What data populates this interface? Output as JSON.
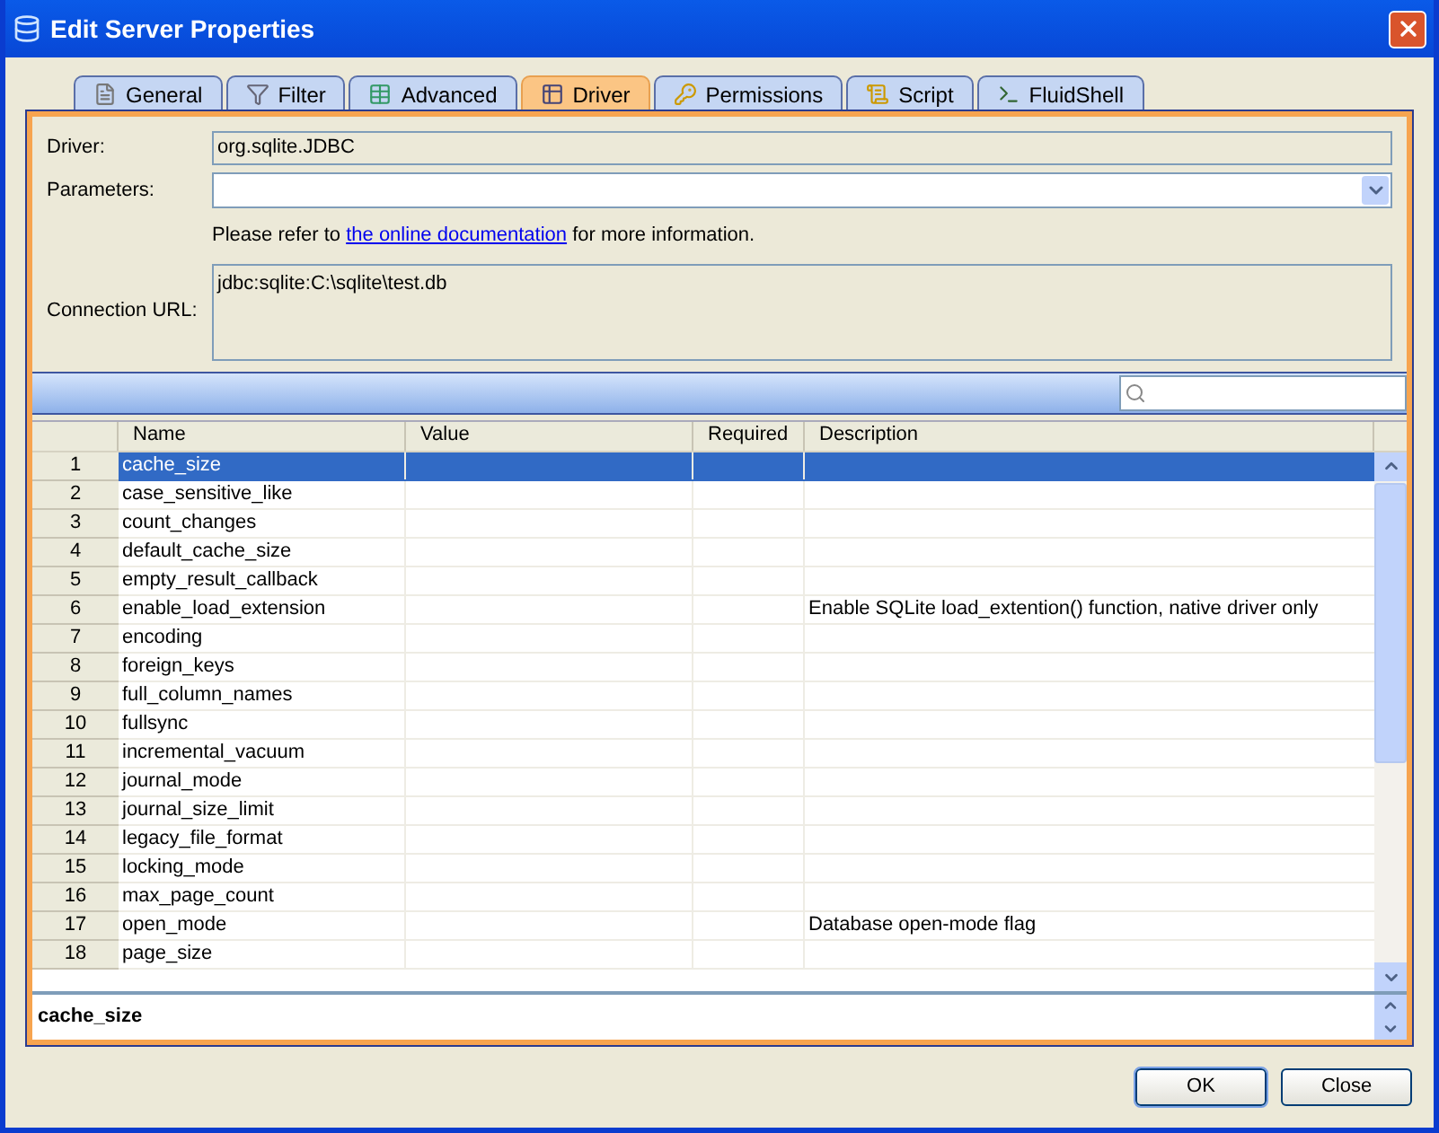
{
  "window": {
    "title": "Edit Server Properties"
  },
  "tabs": [
    {
      "label": "General",
      "selected": false
    },
    {
      "label": "Filter",
      "selected": false
    },
    {
      "label": "Advanced",
      "selected": false
    },
    {
      "label": "Driver",
      "selected": true
    },
    {
      "label": "Permissions",
      "selected": false
    },
    {
      "label": "Script",
      "selected": false
    },
    {
      "label": "FluidShell",
      "selected": false
    }
  ],
  "form": {
    "driver_label": "Driver:",
    "driver_value": "org.sqlite.JDBC",
    "parameters_label": "Parameters:",
    "note_before": "Please refer to ",
    "note_link": "the online documentation",
    "note_after": " for more information.",
    "url_label": "Connection URL:",
    "url_value": "jdbc:sqlite:C:\\sqlite\\test.db"
  },
  "table": {
    "columns": [
      "Name",
      "Value",
      "Required",
      "Description"
    ],
    "rows": [
      {
        "number": "1",
        "name": "cache_size",
        "selected": true
      },
      {
        "number": "2",
        "name": "case_sensitive_like",
        "selected": false
      },
      {
        "number": "3",
        "name": "count_changes",
        "selected": false
      },
      {
        "number": "4",
        "name": "default_cache_size",
        "selected": false
      },
      {
        "number": "5",
        "name": "empty_result_callback",
        "selected": false
      },
      {
        "number": "6",
        "name": "enable_load_extension",
        "description": "Enable SQLite load_extention() function, native driver only",
        "selected": false
      },
      {
        "number": "7",
        "name": "encoding",
        "selected": false
      },
      {
        "number": "8",
        "name": "foreign_keys",
        "selected": false
      },
      {
        "number": "9",
        "name": "full_column_names",
        "selected": false
      },
      {
        "number": "10",
        "name": "fullsync",
        "selected": false
      },
      {
        "number": "11",
        "name": "incremental_vacuum",
        "selected": false
      },
      {
        "number": "12",
        "name": "journal_mode",
        "selected": false
      },
      {
        "number": "13",
        "name": "journal_size_limit",
        "selected": false
      },
      {
        "number": "14",
        "name": "legacy_file_format",
        "selected": false
      },
      {
        "number": "15",
        "name": "locking_mode",
        "selected": false
      },
      {
        "number": "16",
        "name": "max_page_count",
        "selected": false
      },
      {
        "number": "17",
        "name": "open_mode",
        "description": "Database open-mode flag",
        "selected": false
      },
      {
        "number": "18",
        "name": "page_size",
        "selected": false
      }
    ]
  },
  "detail": {
    "text": "cache_size"
  },
  "buttons": [
    "OK",
    "Close"
  ]
}
